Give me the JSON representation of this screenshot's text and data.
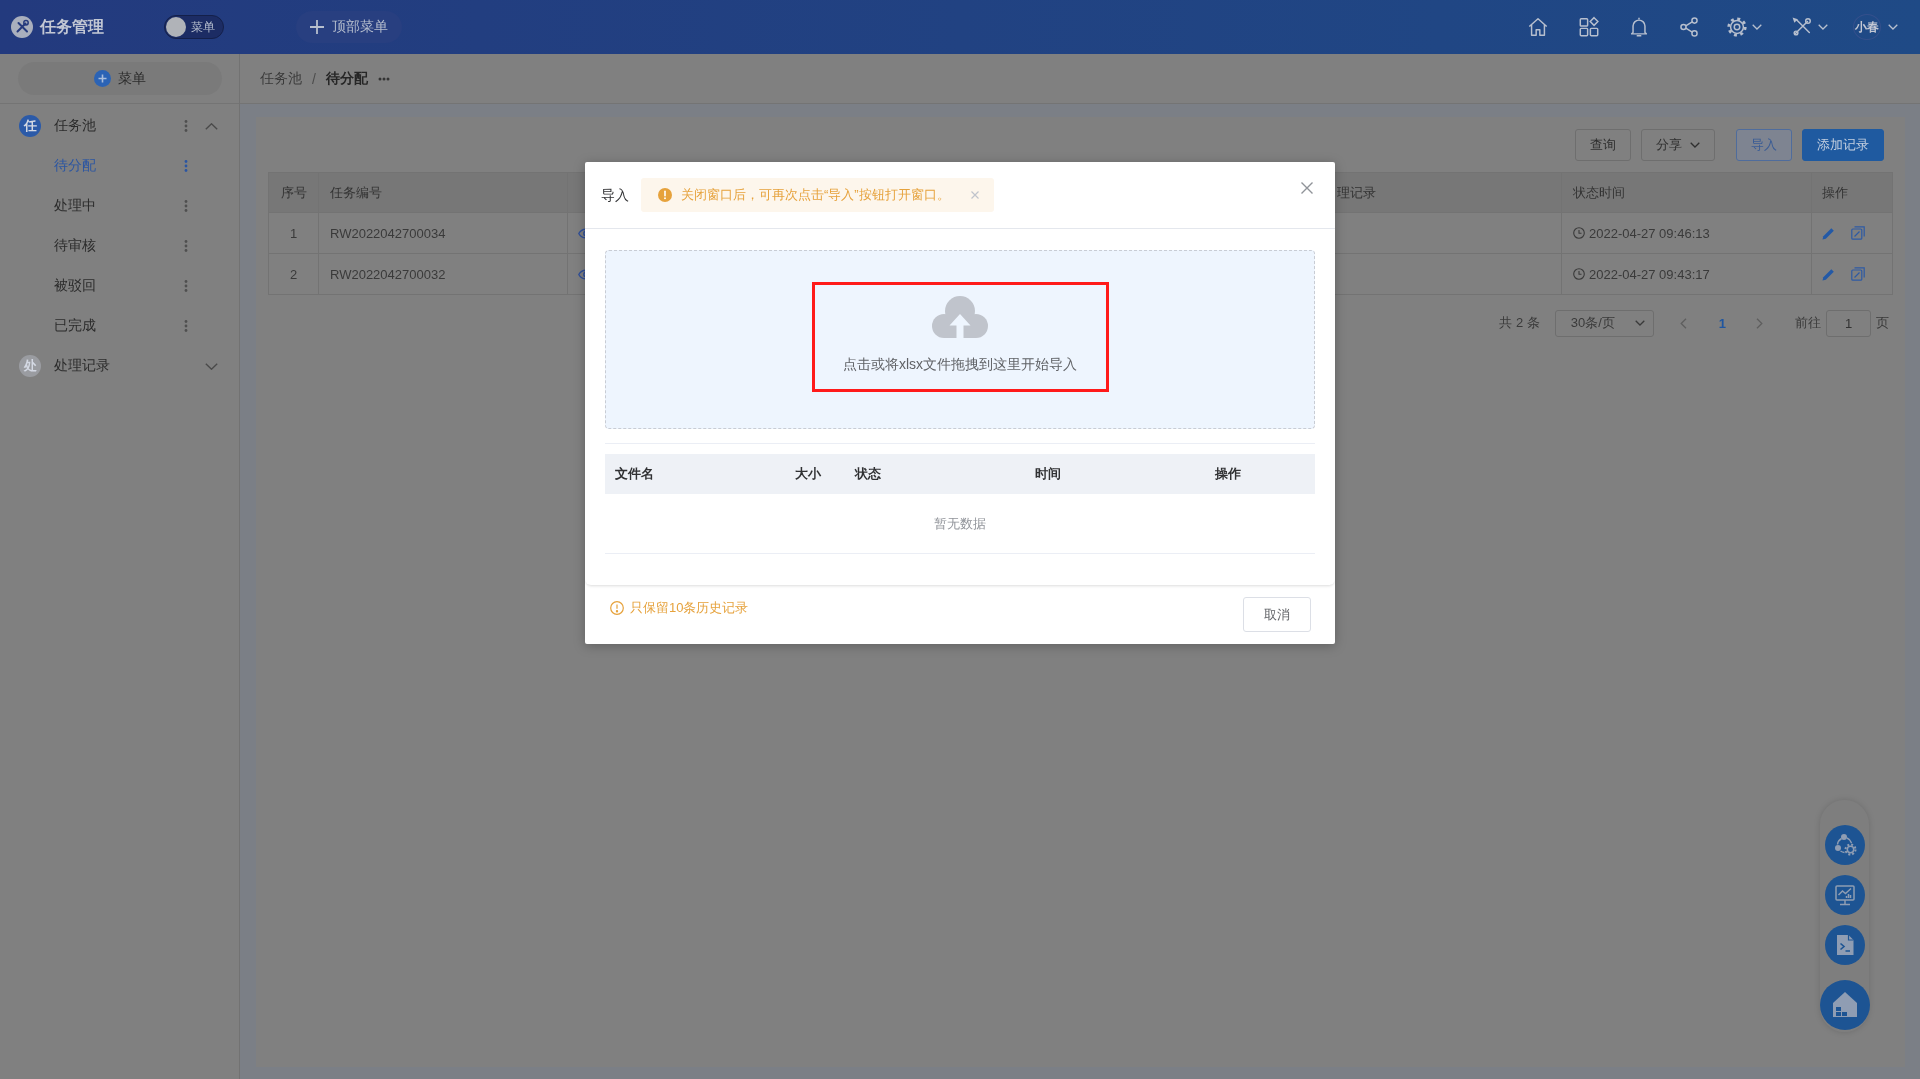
{
  "header": {
    "title": "任务管理",
    "menu_toggle": {
      "label": "菜单",
      "on": false
    },
    "top_menu_button": "顶部菜单",
    "user": "小春"
  },
  "sidebar": {
    "add_button": "菜单",
    "groups": [
      {
        "badge": "任",
        "label": "任务池",
        "color": "#2b5aa8",
        "selected": false,
        "expanded": true,
        "children": [
          {
            "label": "待分配",
            "selected": true
          },
          {
            "label": "处理中",
            "selected": false
          },
          {
            "label": "待审核",
            "selected": false
          },
          {
            "label": "被驳回",
            "selected": false
          },
          {
            "label": "已完成",
            "selected": false
          }
        ]
      },
      {
        "badge": "处",
        "label": "处理记录",
        "color": "#9a9ca1",
        "selected": false,
        "expanded": false
      }
    ]
  },
  "breadcrumb": {
    "items": [
      "任务池",
      "待分配"
    ],
    "separator": "/"
  },
  "toolbar": {
    "buttons": [
      {
        "label": "查询",
        "kind": "default"
      },
      {
        "label": "分享",
        "kind": "dropdown"
      },
      {
        "label": "导入",
        "kind": "plain"
      },
      {
        "label": "添加记录",
        "kind": "primary"
      }
    ]
  },
  "table": {
    "columns": {
      "index": "序号",
      "task_no": "任务编号",
      "column_4": "理记录",
      "status_time": "状态时间",
      "actions": "操作"
    },
    "rows": [
      {
        "index": "1",
        "task_no": "RW2022042700034",
        "status_time": "2022-04-27 09:46:13"
      },
      {
        "index": "2",
        "task_no": "RW2022042700032",
        "status_time": "2022-04-27 09:43:17"
      }
    ]
  },
  "pagination": {
    "total": "共 2 条",
    "page_size": "30条/页",
    "pages": [
      {
        "label": "1",
        "selected": true
      }
    ],
    "goto_label": "前往",
    "goto_value": "1",
    "goto_suffix": "页"
  },
  "dialog": {
    "title": "导入",
    "alert": "关闭窗口后，可再次点击“导入”按钮打开窗口。",
    "upload": {
      "hint": "点击或将xlsx文件拖拽到这里开始导入",
      "highlighted": true
    },
    "file_table": {
      "columns": [
        "文件名",
        "大小",
        "状态",
        "时间",
        "操作"
      ],
      "empty_text": "暂无数据"
    },
    "note": "只保留10条历史记录",
    "cancel_button": "取消"
  }
}
